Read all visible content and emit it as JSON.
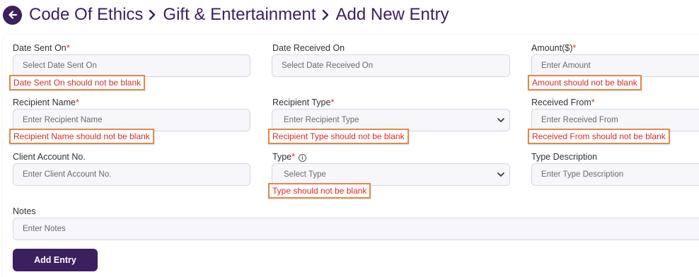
{
  "breadcrumb": {
    "items": [
      "Code Of Ethics",
      "Gift & Entertainment",
      "Add New Entry"
    ]
  },
  "form": {
    "date_sent_on": {
      "label": "Date Sent On",
      "required_mark": "*",
      "placeholder": "Select Date Sent On",
      "error": "Date Sent On should not be blank"
    },
    "date_received_on": {
      "label": "Date Received On",
      "placeholder": "Select Date Received On"
    },
    "amount": {
      "label": "Amount($)",
      "required_mark": "*",
      "placeholder": "Enter Amount",
      "error": "Amount should not be blank"
    },
    "recipient_name": {
      "label": "Recipient Name",
      "required_mark": "*",
      "placeholder": "Enter Recipient Name",
      "error": "Recipient Name should not be blank"
    },
    "recipient_type": {
      "label": "Recipient Type",
      "required_mark": "*",
      "selected": "Enter Recipient Type",
      "error": "Recipient Type should not be blank"
    },
    "received_from": {
      "label": "Received From",
      "required_mark": "*",
      "placeholder": "Enter Received From",
      "error": "Received From should not be blank"
    },
    "client_account": {
      "label": "Client Account No.",
      "placeholder": "Enter Client Account No."
    },
    "type": {
      "label": "Type",
      "required_mark": "*",
      "info_icon": "i",
      "selected": "Select Type",
      "error": "Type should not be blank"
    },
    "type_description": {
      "label": "Type Description",
      "placeholder": "Enter Type Description"
    },
    "notes": {
      "label": "Notes",
      "placeholder": "Enter Notes"
    }
  },
  "actions": {
    "add_entry": "Add Entry"
  },
  "colors": {
    "accent": "#3b1f5e",
    "error_text": "#d92a2a",
    "error_border": "#e08a4a",
    "field_bg": "#f6f6fb"
  }
}
